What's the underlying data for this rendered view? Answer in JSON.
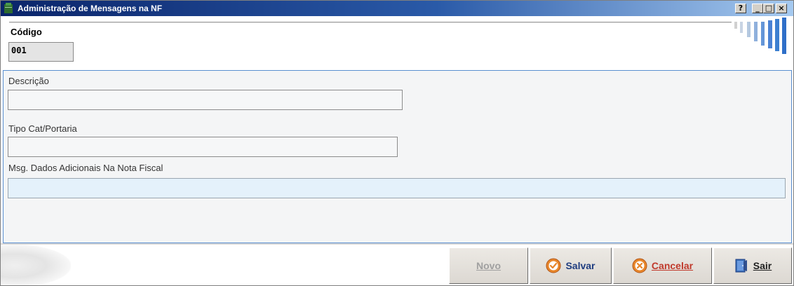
{
  "window": {
    "title": "Administração de Mensagens na NF",
    "help_btn": "?",
    "min_btn": "_",
    "max_btn": "□",
    "close_btn": "×"
  },
  "codigo": {
    "label": "Código",
    "value": "001"
  },
  "form": {
    "descricao": {
      "label": "Descrição",
      "value": ""
    },
    "tipo_cat": {
      "label": "Tipo Cat/Portaria",
      "value": ""
    },
    "msg_dados": {
      "label": "Msg. Dados Adicionais Na Nota Fiscal",
      "value": ""
    }
  },
  "buttons": {
    "novo": {
      "label": "Novo",
      "enabled": false
    },
    "salvar": {
      "label": "Salvar",
      "icon": "check-circle-icon"
    },
    "cancelar": {
      "label": "Cancelar",
      "icon": "cancel-circle-icon"
    },
    "sair": {
      "label": "Sair",
      "icon": "door-exit-icon"
    }
  },
  "colors": {
    "title_start": "#0a246a",
    "title_end": "#a6caf0",
    "panel_border": "#5a8fd0",
    "accent_bars": "#3c7fd0"
  }
}
